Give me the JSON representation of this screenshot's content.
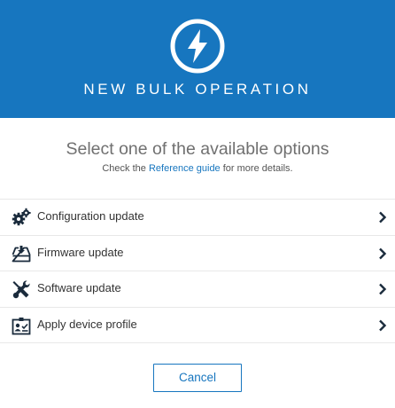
{
  "header": {
    "title": "NEW BULK OPERATION",
    "icon": "lightning-bolt-icon",
    "background_color": "#1776bf"
  },
  "intro": {
    "subtitle": "Select one of the available options",
    "hint_prefix": "Check the",
    "hint_link": "Reference guide",
    "hint_suffix": "for more details."
  },
  "options": [
    {
      "label": "Configuration update",
      "icon": "gears-icon"
    },
    {
      "label": "Firmware update",
      "icon": "firmware-download-icon"
    },
    {
      "label": "Software update",
      "icon": "software-tools-icon"
    },
    {
      "label": "Apply device profile",
      "icon": "device-profile-icon"
    }
  ],
  "footer": {
    "cancel_label": "Cancel"
  },
  "colors": {
    "accent": "#1776bf",
    "icon": "#1a2b3c"
  }
}
